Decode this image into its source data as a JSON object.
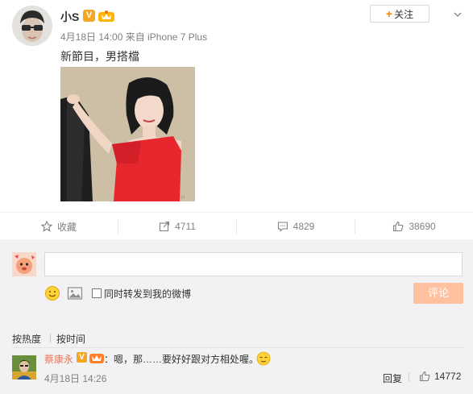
{
  "post": {
    "username": "小S",
    "verified_badge": "V",
    "meta": "4月18日 14:00 来自 iPhone 7 Plus",
    "follow_plus": "+",
    "follow_label": "关注",
    "text": "新節目，男搭檔",
    "icons": [
      "v-verified-icon",
      "vip-crown-icon",
      "chevron-down-icon"
    ]
  },
  "actions": {
    "favorite": "收藏",
    "repost": "4711",
    "comment": "4829",
    "like": "38690"
  },
  "composer": {
    "repost_label": "同时转发到我的微博",
    "submit": "评论"
  },
  "comments": {
    "sort_hot": "按热度",
    "sort_time": "按时间",
    "items": [
      {
        "user": "蔡康永",
        "badge": "V",
        "text": "：嗯，那……要好好跟对方相处喔。",
        "time": "4月18日 14:26",
        "reply": "回复",
        "likes": "14772"
      }
    ]
  },
  "colors": {
    "accent_orange": "#ff8200",
    "comment_user": "#eb7350",
    "submit_bg": "#ffc09f",
    "dress_red": "#e8262d"
  }
}
